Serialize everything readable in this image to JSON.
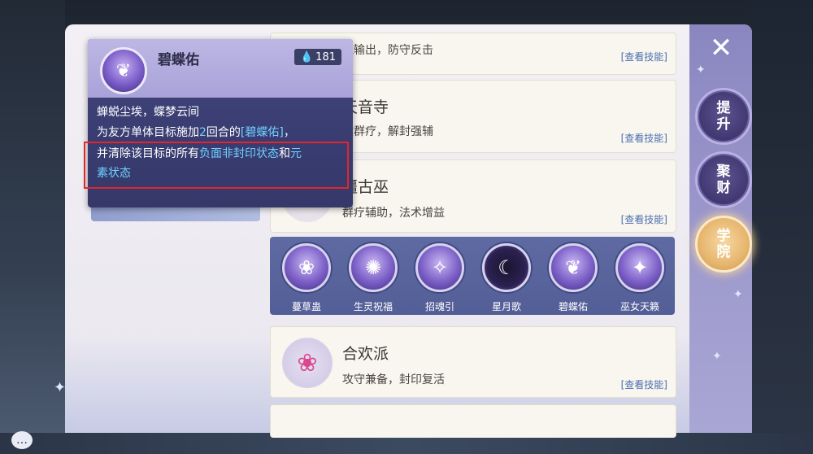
{
  "tooltip": {
    "name": "碧蝶佑",
    "cost": "181",
    "line1": "蝉蜕尘埃，蝶梦云间",
    "line2_a": "为友方单体目标施加",
    "line2_num": "2",
    "line2_b": "回合的",
    "line2_hl": "[碧蝶佑]",
    "line2_c": "，",
    "line3_a": "并清除该目标的所有",
    "line3_hl": "负面非封印状态",
    "line3_b": "和",
    "line3_hl2": "元",
    "line4_hl": "素状态"
  },
  "cards": [
    {
      "title": "",
      "desc": "理输出，防守反击",
      "link": "[查看技能]"
    },
    {
      "title": "天音寺",
      "desc": "救群疗，解封强辅",
      "link": "[查看技能]"
    },
    {
      "title": "疆古巫",
      "desc": "群疗辅助，法术增益",
      "link": "[查看技能]"
    },
    {
      "title": "合欢派",
      "desc": "攻守兼备，封印复活",
      "link": "[查看技能]"
    }
  ],
  "skills": [
    {
      "label": "蔓草蛊",
      "glyph": "❀"
    },
    {
      "label": "生灵祝福",
      "glyph": "✺"
    },
    {
      "label": "招魂引",
      "glyph": "✧"
    },
    {
      "label": "星月歌",
      "glyph": "☾"
    },
    {
      "label": "碧蝶佑",
      "glyph": "❦"
    },
    {
      "label": "巫女天籁",
      "glyph": "✦"
    }
  ],
  "rail": {
    "close": "✕",
    "btn1": "提升",
    "btn2": "聚财",
    "btn3": "学院"
  },
  "colors": {
    "highlight": "#6fd1ff",
    "red_box": "#e1262c",
    "link": "#4c6fb0"
  }
}
